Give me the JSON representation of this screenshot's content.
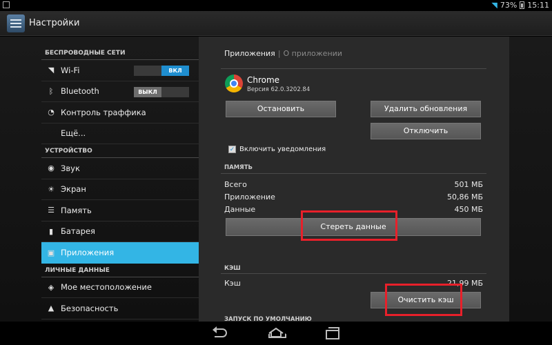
{
  "status_bar": {
    "battery": "73%",
    "time": "15:11"
  },
  "action_bar": {
    "title": "Настройки"
  },
  "sidebar": {
    "sections": [
      {
        "header": "БЕСПРОВОДНЫЕ СЕТИ"
      },
      {
        "header": "УСТРОЙСТВО"
      },
      {
        "header": "ЛИЧНЫЕ ДАННЫЕ"
      }
    ],
    "items": [
      {
        "label": "Wi-Fi",
        "icon": "wifi-icon",
        "toggle": "ВКЛ"
      },
      {
        "label": "Bluetooth",
        "icon": "bluetooth-icon",
        "toggle": "ВЫКЛ"
      },
      {
        "label": "Контроль траффика",
        "icon": "traffic-icon"
      },
      {
        "label": "Ещё..."
      },
      {
        "label": "Звук",
        "icon": "sound-icon"
      },
      {
        "label": "Экран",
        "icon": "display-icon"
      },
      {
        "label": "Память",
        "icon": "storage-icon"
      },
      {
        "label": "Батарея",
        "icon": "battery-icon"
      },
      {
        "label": "Приложения",
        "icon": "apps-icon",
        "active": true
      },
      {
        "label": "Мое местоположение",
        "icon": "location-icon"
      },
      {
        "label": "Безопасность",
        "icon": "lock-icon"
      }
    ]
  },
  "detail": {
    "breadcrumb": {
      "primary": "Приложения",
      "secondary": "О приложении"
    },
    "app": {
      "name": "Chrome",
      "version": "Версия 62.0.3202.84"
    },
    "buttons": {
      "stop": "Остановить",
      "uninstall_updates": "Удалить обновления",
      "disable": "Отключить",
      "clear_data": "Стереть данные",
      "clear_cache": "Очистить кэш"
    },
    "notifications_label": "Включить уведомления",
    "memory": {
      "header": "ПАМЯТЬ",
      "rows": [
        {
          "label": "Всего",
          "value": "501 МБ"
        },
        {
          "label": "Приложение",
          "value": "50,86 МБ"
        },
        {
          "label": "Данные",
          "value": "450 МБ"
        }
      ]
    },
    "cache": {
      "header": "КЭШ",
      "label": "Кэш",
      "value": "21,99 МБ"
    },
    "launch_default_header": "ЗАПУСК ПО УМОЛЧАНИЮ"
  },
  "colors": {
    "accent": "#33b5e5",
    "highlight": "#e8202a"
  }
}
